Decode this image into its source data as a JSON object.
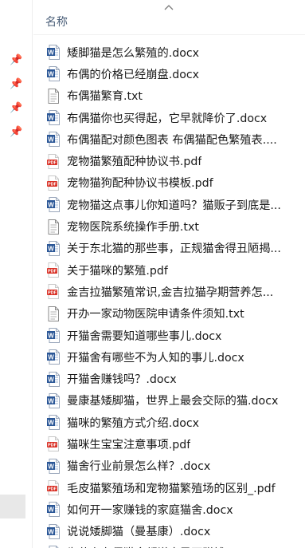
{
  "header": {
    "column_name": "名称",
    "sort_icon": "chevron-up-icon"
  },
  "sidebar": {
    "pins": [
      "pin-icon",
      "pin-icon",
      "pin-icon",
      "pin-icon"
    ]
  },
  "files": [
    {
      "name": "矮脚猫是怎么繁殖的.docx",
      "type": "docx"
    },
    {
      "name": "布偶的价格已经崩盘.docx",
      "type": "docx"
    },
    {
      "name": "布偶猫繁育.txt",
      "type": "txt"
    },
    {
      "name": "布偶猫你也买得起，它早就降价了.docx",
      "type": "docx"
    },
    {
      "name": "布偶猫配对颜色图表 布偶猫配色繁殖表....",
      "type": "docx"
    },
    {
      "name": "宠物猫繁殖配种协议书.pdf",
      "type": "pdf"
    },
    {
      "name": "宠物猫狗配种协议书模板.pdf",
      "type": "pdf"
    },
    {
      "name": "宠物猫这点事儿你知道吗？猫贩子到底是...",
      "type": "docx"
    },
    {
      "name": "宠物医院系统操作手册.txt",
      "type": "txt"
    },
    {
      "name": "关于东北猫的那些事，正规猫舍得丑陋揭...",
      "type": "docx"
    },
    {
      "name": "关于猫咪的繁殖.pdf",
      "type": "pdf"
    },
    {
      "name": "金吉拉猫繁殖常识,金吉拉猫孕期营养怎...",
      "type": "pdf"
    },
    {
      "name": "开办一家动物医院申请条件须知.txt",
      "type": "txt"
    },
    {
      "name": "开猫舍需要知道哪些事儿.docx",
      "type": "docx"
    },
    {
      "name": "开猫舍有哪些不为人知的事儿.docx",
      "type": "docx"
    },
    {
      "name": "开猫舍赚钱吗？.docx",
      "type": "docx"
    },
    {
      "name": "曼康基矮脚猫，世界上最会交际的猫.docx",
      "type": "docx"
    },
    {
      "name": "猫咪的繁殖方式介绍.docx",
      "type": "docx"
    },
    {
      "name": "猫咪生宝宝注意事项.pdf",
      "type": "pdf"
    },
    {
      "name": "猫舍行业前景怎么样？.docx",
      "type": "docx"
    },
    {
      "name": "毛皮猫繁殖场和宠物猫繁殖场的区别_.pdf",
      "type": "pdf"
    },
    {
      "name": "如何开一家赚钱的家庭猫舍.docx",
      "type": "docx"
    },
    {
      "name": "说说矮脚猫（曼基康）.docx",
      "type": "docx"
    },
    {
      "name": "为什么布偶猫舍都说自己不赚钱？.docx",
      "type": "docx"
    }
  ],
  "colors": {
    "docx_blue": "#2b5797",
    "pdf_red": "#d93025",
    "txt_gray": "#8a8a8a"
  }
}
